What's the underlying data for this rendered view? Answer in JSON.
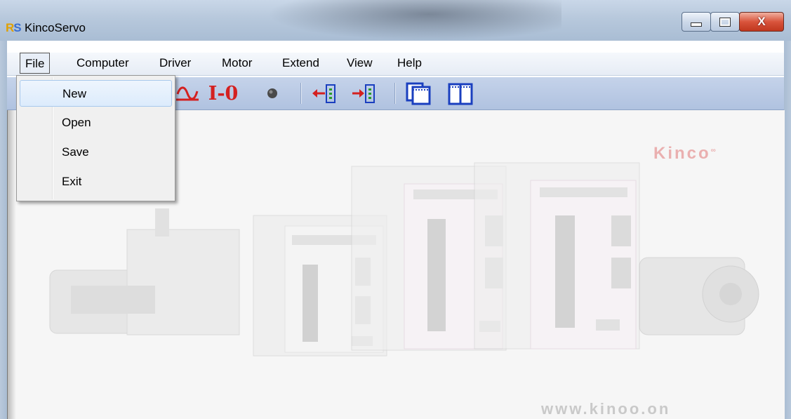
{
  "window": {
    "title": "KincoServo",
    "icon_label": "KS",
    "controls": [
      "minimize-icon",
      "maximize-icon",
      "close-icon"
    ],
    "close_glyph": "X"
  },
  "menubar": {
    "items": [
      "File",
      "Computer",
      "Driver",
      "Motor",
      "Extend",
      "View",
      "Help"
    ],
    "active": "File"
  },
  "file_menu": {
    "items": [
      "New",
      "Open",
      "Save",
      "Exit"
    ],
    "highlighted": "New"
  },
  "toolbar": {
    "io_label": "I-0",
    "icons": [
      "oscilloscope-icon",
      "io-monitor-icon",
      "status-led-icon",
      "upload-icon",
      "download-icon",
      "copy-window-icon",
      "window-split-icon"
    ]
  },
  "background": {
    "logo_text": "Kinco",
    "website": "www.kinoo.on"
  },
  "colors": {
    "titlebar": "#b7c8dc",
    "toolbar": "#b0c2e0",
    "icon_red": "#d42020",
    "icon_blue": "#1a3fbf",
    "menu_highlight": "#dcebfc"
  }
}
